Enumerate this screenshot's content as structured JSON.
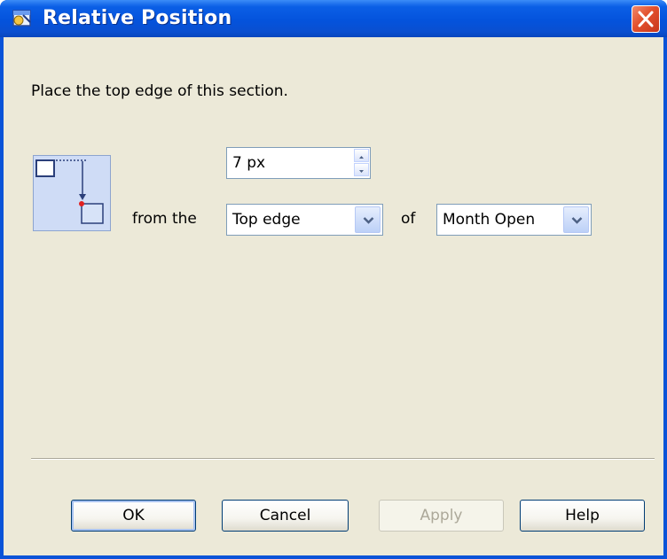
{
  "window": {
    "title": "Relative Position"
  },
  "instruction": "Place the top edge of this section.",
  "offset": {
    "value": "7 px"
  },
  "labels": {
    "from_the": "from the",
    "of": "of"
  },
  "edge_select": {
    "selected": "Top edge"
  },
  "target_select": {
    "selected": "Month Open"
  },
  "buttons": {
    "ok": "OK",
    "cancel": "Cancel",
    "apply": "Apply",
    "help": "Help"
  },
  "colors": {
    "title_bar": "#0453dc",
    "dialog_bg": "#ece9d8",
    "close_button": "#e2502d"
  }
}
